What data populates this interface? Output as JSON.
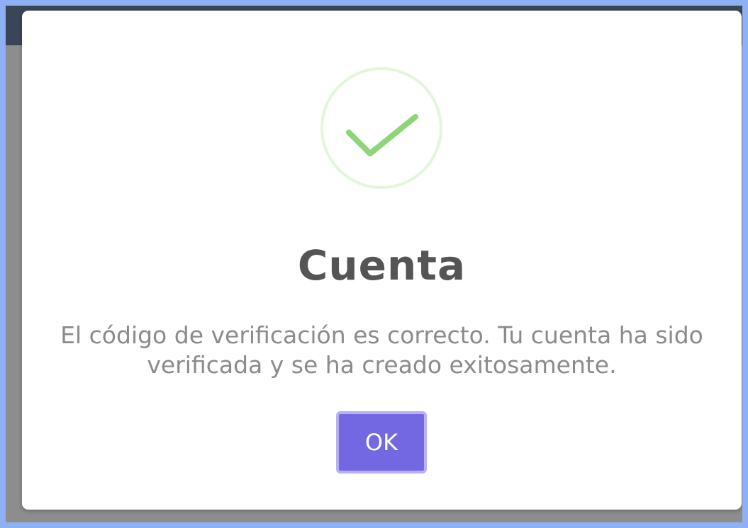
{
  "modal": {
    "title": "Cuenta",
    "message": "El código de verificación es correcto. Tu cuenta ha sido verificada y se ha creado exitosamente.",
    "icon": "success-check-icon",
    "ok_label": "OK"
  },
  "colors": {
    "success": "#8ed57a",
    "success_ring": "#e3f5dd",
    "button": "#7468e2",
    "title": "#555555",
    "message": "#8b8b8b",
    "frame": "#8fb0f2"
  }
}
